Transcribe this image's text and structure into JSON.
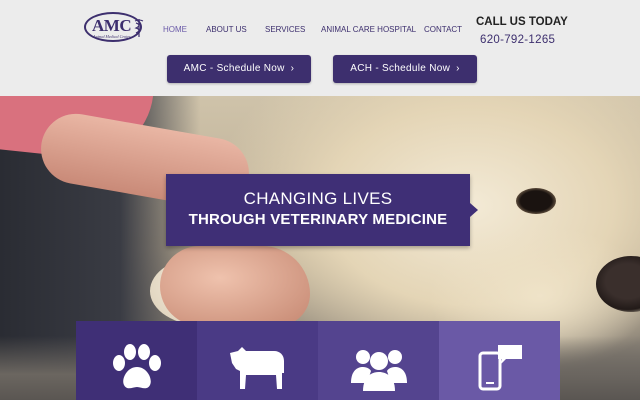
{
  "logo": {
    "text": "AMC",
    "subtitle": "Animal Medical Center"
  },
  "nav": [
    {
      "label": "HOME",
      "active": true
    },
    {
      "label": "ABOUT US"
    },
    {
      "label": "SERVICES"
    },
    {
      "label": "ANIMAL CARE HOSPITAL"
    },
    {
      "label": "CONTACT"
    }
  ],
  "call": {
    "title": "CALL US TODAY",
    "phone": "620-792-1265"
  },
  "buttons": [
    {
      "label": "AMC - Schedule Now",
      "icon": "chevron-right-icon"
    },
    {
      "label": "ACH - Schedule Now",
      "icon": "chevron-right-icon"
    }
  ],
  "hero": {
    "line1": "CHANGING LIVES",
    "line2": "THROUGH VETERINARY MEDICINE"
  },
  "tiles": [
    {
      "icon": "paw-icon",
      "color": "#3f2f76"
    },
    {
      "icon": "cow-icon",
      "color": "#4a3a85"
    },
    {
      "icon": "people-icon",
      "color": "#54448f"
    },
    {
      "icon": "mobile-chat-icon",
      "color": "#6a59a6"
    }
  ],
  "colors": {
    "brand": "#3d2f6e",
    "header_bg": "#ececec",
    "accent": "#6a5aa8"
  }
}
